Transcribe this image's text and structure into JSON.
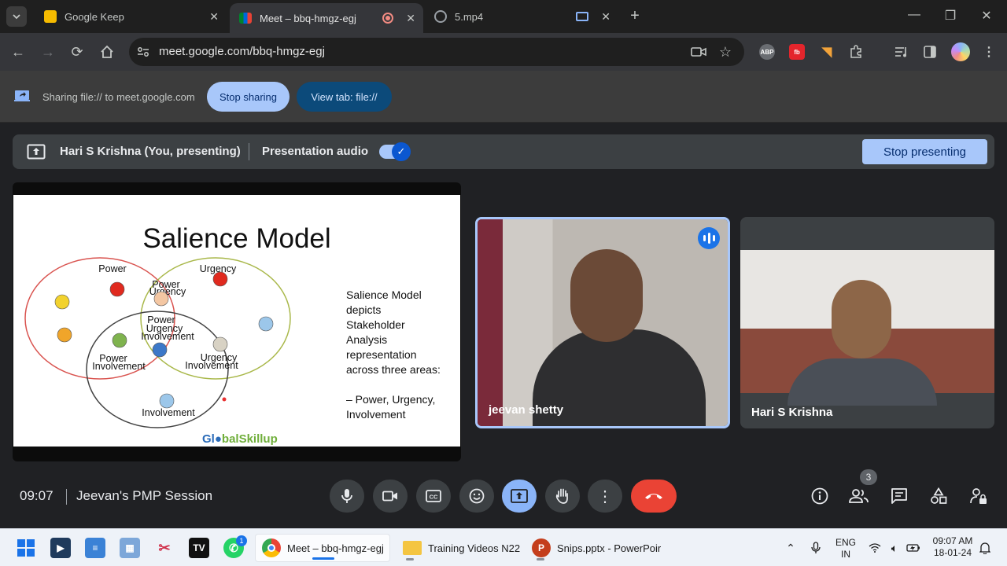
{
  "browser": {
    "tabs": [
      {
        "title": "Google Keep",
        "icon": "google-keep-icon",
        "active": false
      },
      {
        "title": "Meet – bbq-hmgz-egj",
        "icon": "google-meet-icon",
        "active": true
      },
      {
        "title": "5.mp4",
        "icon": "globe-icon",
        "active": false
      }
    ],
    "url": "meet.google.com/bbq-hmgz-egj",
    "extensions": [
      "ABP",
      "fb"
    ]
  },
  "share_infobar": {
    "text": "Sharing file:// to meet.google.com",
    "stop_sharing": "Stop sharing",
    "view_tab": "View tab: file://"
  },
  "presenting_bar": {
    "presenter": "Hari S Krishna (You, presenting)",
    "audio_label": "Presentation audio",
    "audio_enabled": true,
    "stop_presenting": "Stop presenting"
  },
  "slide": {
    "title": "Salience Model",
    "labels": {
      "power": "Power",
      "urgency": "Urgency",
      "power_urgency_1": "Power",
      "power_urgency_2": "Urgency",
      "pui_1": "Power",
      "pui_2": "Urgency",
      "pui_3": "Involvement",
      "pi_1": "Power",
      "pi_2": "Involvement",
      "ui_1": "Urgency",
      "ui_2": "Involvement",
      "involvement": "Involvement"
    },
    "description_lines": [
      "Salience Model",
      "depicts",
      "Stakeholder",
      "Analysis",
      "representation",
      "across three areas:"
    ],
    "bullet_lines": [
      "– Power, Urgency,",
      "Involvement"
    ],
    "brand_part1": "Gl",
    "brand_part2": "balSkillup"
  },
  "participants": [
    {
      "name": "jeevan shetty",
      "speaking": true
    },
    {
      "name": "Hari S Krishna",
      "speaking": false
    }
  ],
  "call": {
    "time": "09:07",
    "meeting_name": "Jeevan's PMP Session",
    "participant_count": "3",
    "colors": {
      "present_active": "#8ab4f8",
      "hangup": "#ea4335"
    }
  },
  "taskbar": {
    "apps": [
      {
        "label": "Meet – bbq-hmgz-egj",
        "icon": "chrome-icon"
      },
      {
        "label": "Training Videos N22",
        "icon": "folder-icon"
      },
      {
        "label": "Snips.pptx - PowerPoir",
        "icon": "powerpoint-icon"
      }
    ],
    "whatsapp_badge": "1",
    "language_1": "ENG",
    "language_2": "IN",
    "clock_time": "09:07 AM",
    "clock_date": "18-01-24"
  }
}
